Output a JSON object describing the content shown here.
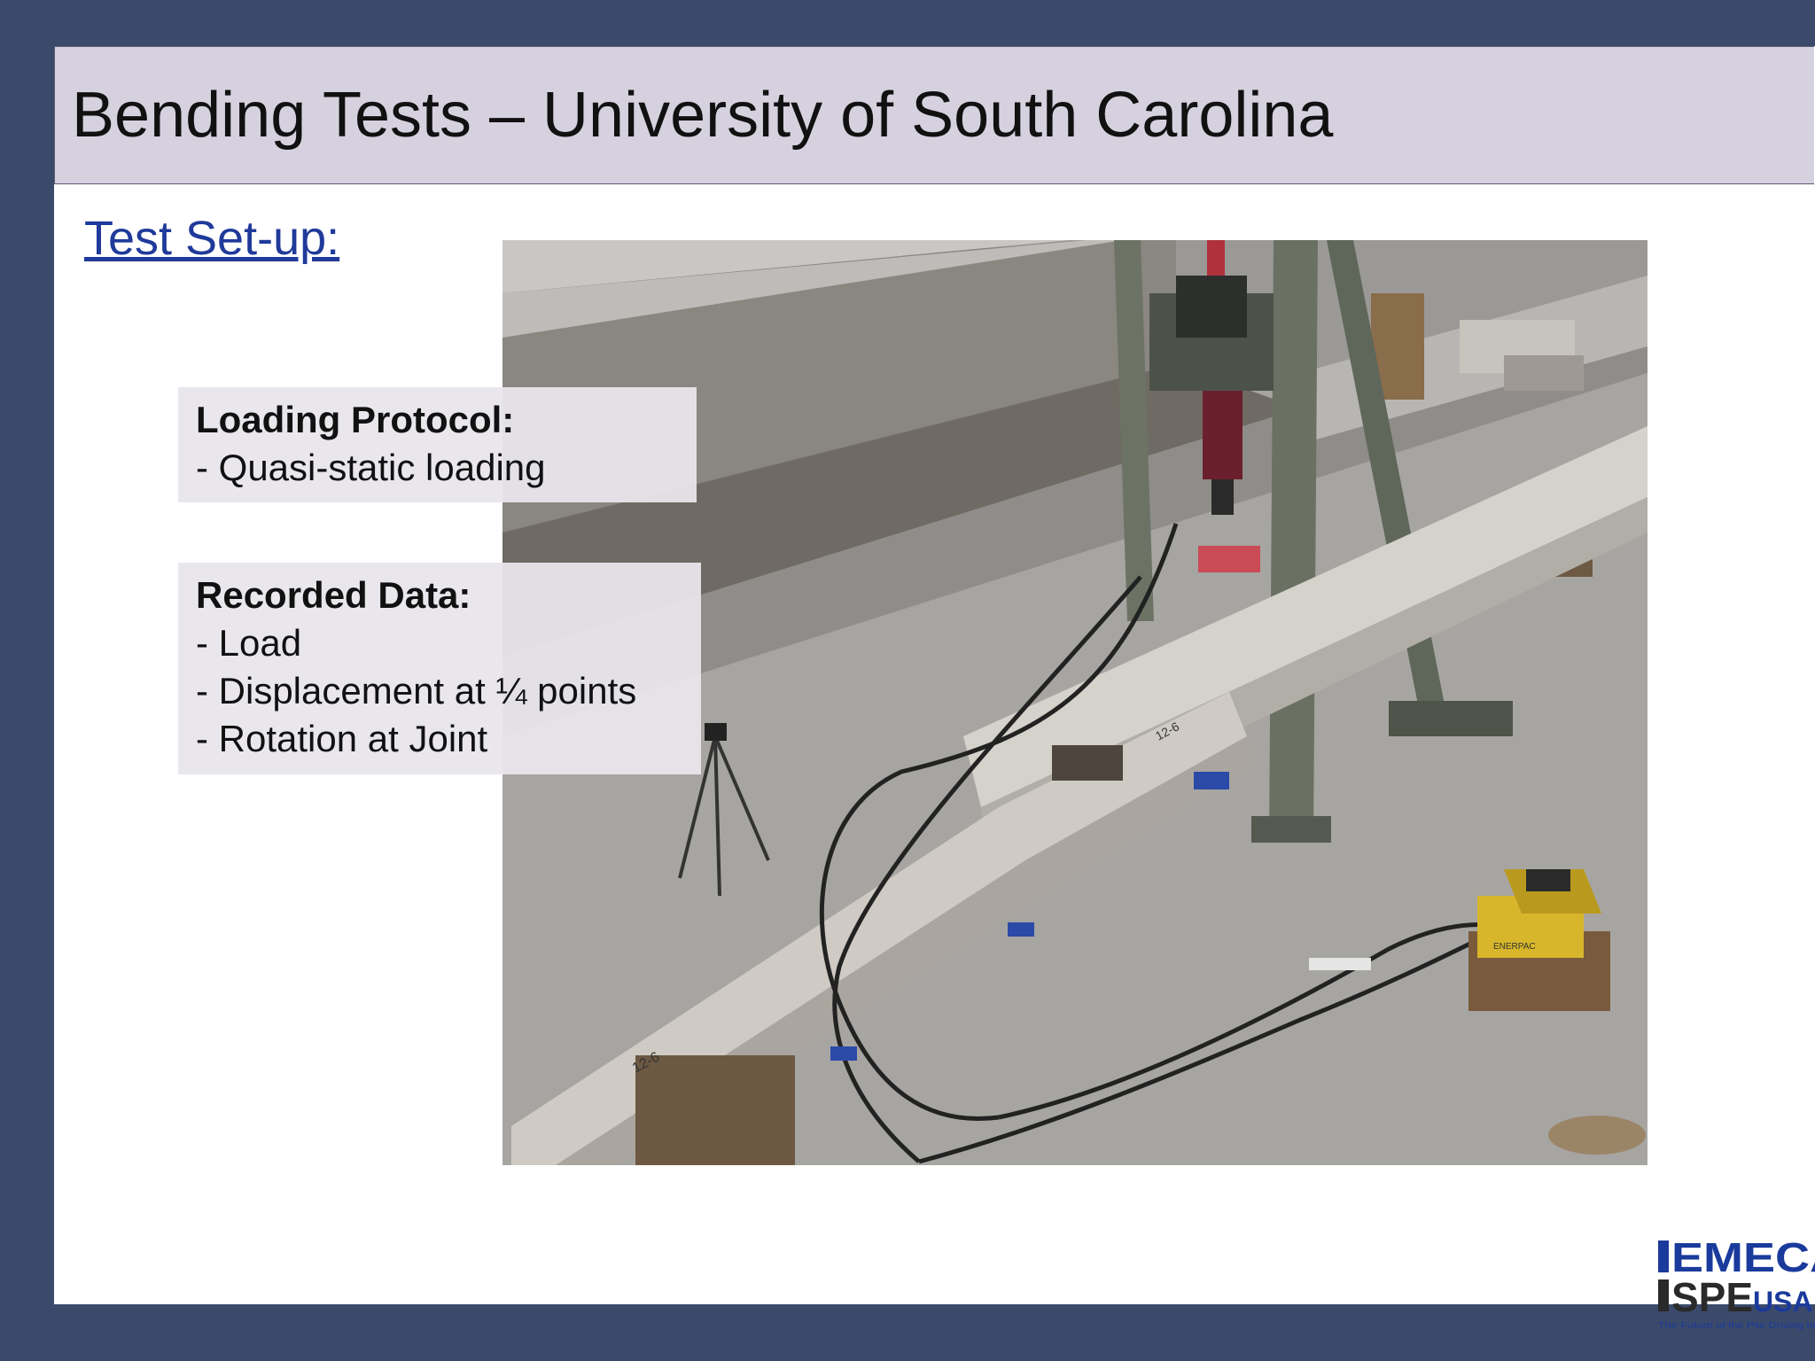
{
  "title": "Bending Tests – University of South Carolina",
  "subtitle": "Test Set-up:",
  "loading_protocol": {
    "heading": "Loading Protocol:",
    "items": [
      "- Quasi-static loading"
    ]
  },
  "recorded_data": {
    "heading": "Recorded Data:",
    "items": [
      "- Load",
      "- Displacement at ¼ points",
      "- Rotation at Joint"
    ]
  },
  "photo": {
    "beam_markings": [
      "12-6",
      "12-6"
    ],
    "pump_label": "ENERPAC"
  },
  "logo": {
    "line1": "EMECA",
    "line2_a": "SPE",
    "line2_b": "USA",
    "tagline": "The Future of the Pile Driving Industry"
  },
  "colors": {
    "background": "#3b4a6b",
    "title_bar": "#d6d1de",
    "subtitle_link": "#1f3a9a",
    "logo_blue": "#1a3a9c"
  }
}
